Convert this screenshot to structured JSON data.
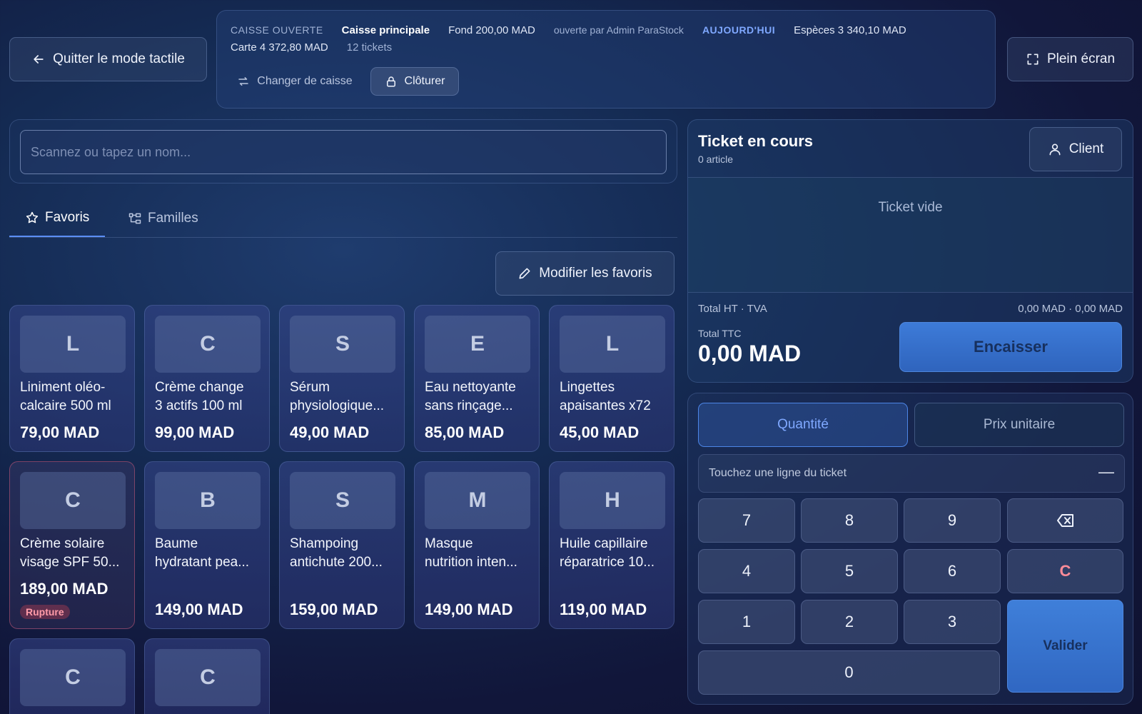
{
  "header": {
    "exit_touch_label": "Quitter le mode tactile",
    "fullscreen_label": "Plein écran",
    "status": {
      "state": "CAISSE OUVERTE",
      "register_name": "Caisse principale",
      "float": "Fond 200,00 MAD",
      "opened_by": "ouverte par Admin ParaStock",
      "period": "AUJOURD'HUI",
      "cash": "Espèces 3 340,10 MAD",
      "card": "Carte 4 372,80 MAD",
      "tickets": "12 tickets",
      "change_register_label": "Changer de caisse",
      "close_register_label": "Clôturer"
    }
  },
  "search": {
    "placeholder": "Scannez ou tapez un nom..."
  },
  "tabs": {
    "favorites": "Favoris",
    "families": "Familles"
  },
  "modify_favorites_label": "Modifier les favoris",
  "products": [
    {
      "letter": "L",
      "name_line1": "Liniment oléo-",
      "name_line2": "calcaire 500 ml",
      "price": "79,00 MAD",
      "badge": ""
    },
    {
      "letter": "C",
      "name_line1": "Crème change",
      "name_line2": "3 actifs 100 ml",
      "price": "99,00 MAD",
      "badge": ""
    },
    {
      "letter": "S",
      "name_line1": "Sérum",
      "name_line2": "physiologique...",
      "price": "49,00 MAD",
      "badge": ""
    },
    {
      "letter": "E",
      "name_line1": "Eau nettoyante",
      "name_line2": "sans rinçage...",
      "price": "85,00 MAD",
      "badge": ""
    },
    {
      "letter": "L",
      "name_line1": "Lingettes",
      "name_line2": "apaisantes x72",
      "price": "45,00 MAD",
      "badge": ""
    },
    {
      "letter": "C",
      "name_line1": "Crème solaire",
      "name_line2": "visage SPF 50...",
      "price": "189,00 MAD",
      "badge": "Rupture"
    },
    {
      "letter": "B",
      "name_line1": "Baume",
      "name_line2": "hydratant pea...",
      "price": "149,00 MAD",
      "badge": ""
    },
    {
      "letter": "S",
      "name_line1": "Shampoing",
      "name_line2": "antichute 200...",
      "price": "159,00 MAD",
      "badge": ""
    },
    {
      "letter": "M",
      "name_line1": "Masque",
      "name_line2": "nutrition inten...",
      "price": "149,00 MAD",
      "badge": ""
    },
    {
      "letter": "H",
      "name_line1": "Huile capillaire",
      "name_line2": "réparatrice 10...",
      "price": "119,00 MAD",
      "badge": ""
    },
    {
      "letter": "C",
      "name_line1": "",
      "name_line2": "",
      "price": "",
      "badge": ""
    },
    {
      "letter": "C",
      "name_line1": "",
      "name_line2": "",
      "price": "",
      "badge": ""
    }
  ],
  "ticket": {
    "title": "Ticket en cours",
    "count": "0 article",
    "client_label": "Client",
    "empty_text": "Ticket vide",
    "totals_label": "Total HT · TVA",
    "totals_value": "0,00 MAD · 0,00 MAD",
    "ttc_label": "Total TTC",
    "ttc_value": "0,00 MAD",
    "checkout_label": "Encaisser"
  },
  "keypad": {
    "mode_quantity": "Quantité",
    "mode_unit_price": "Prix unitaire",
    "line_hint": "Touchez une ligne du ticket",
    "line_hint_dash": "—",
    "keys": [
      "7",
      "8",
      "9",
      "4",
      "5",
      "6",
      "1",
      "2",
      "3",
      "0"
    ],
    "clear_label": "C",
    "validate_label": "Valider"
  },
  "colors": {
    "accent": "#5b8ef5",
    "checkout": "#3d7bd8",
    "out_of_stock": "#ff9ba8"
  }
}
